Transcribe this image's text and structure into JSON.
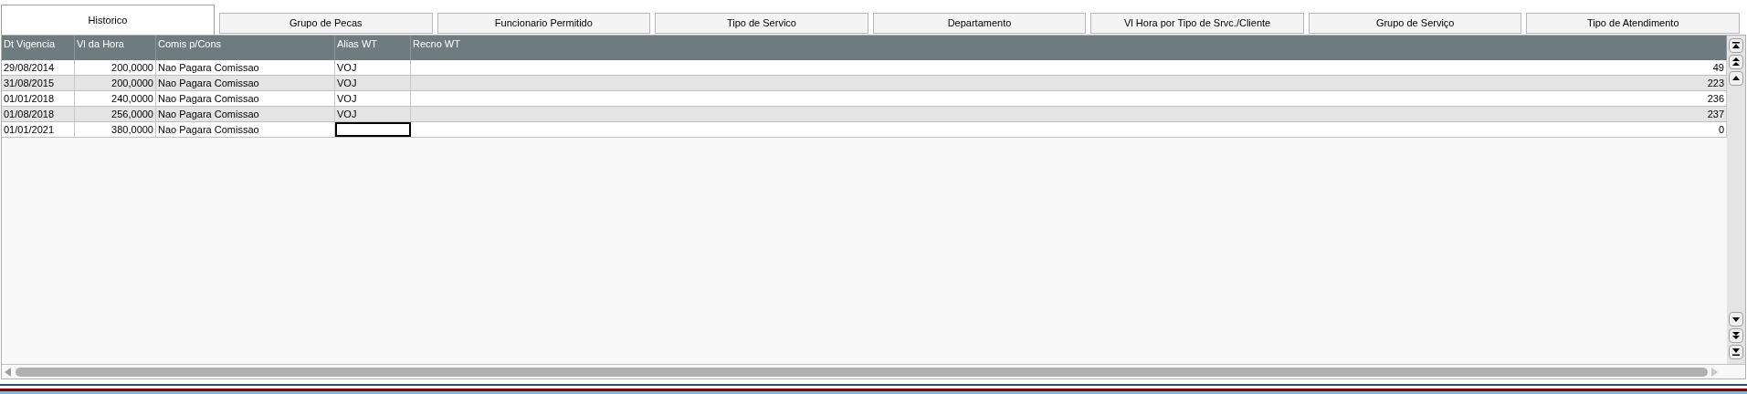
{
  "tabs": [
    {
      "label": "Historico",
      "selected": true
    },
    {
      "label": "Grupo de Pecas",
      "selected": false
    },
    {
      "label": "Funcionario Permitido",
      "selected": false
    },
    {
      "label": "Tipo de Servico",
      "selected": false
    },
    {
      "label": "Departamento",
      "selected": false
    },
    {
      "label": "Vl Hora por Tipo de Srvc./Cliente",
      "selected": false
    },
    {
      "label": "Grupo de Serviço",
      "selected": false
    },
    {
      "label": "Tipo de Atendimento",
      "selected": false
    }
  ],
  "table": {
    "columns": [
      "Dt Vigencia",
      "Vl da Hora",
      "Comis p/Cons",
      "Alias WT",
      "Recno WT"
    ],
    "rows": [
      {
        "cells": [
          "29/08/2014",
          "200,0000",
          "Nao Pagara Comissao",
          "VOJ",
          "49"
        ],
        "focused_cell": false
      },
      {
        "cells": [
          "31/08/2015",
          "200,0000",
          "Nao Pagara Comissao",
          "VOJ",
          "223"
        ],
        "focused_cell": false
      },
      {
        "cells": [
          "01/01/2018",
          "240,0000",
          "Nao Pagara Comissao",
          "VOJ",
          "236"
        ],
        "focused_cell": false
      },
      {
        "cells": [
          "01/08/2018",
          "256,0000",
          "Nao Pagara Comissao",
          "VOJ",
          "237"
        ],
        "focused_cell": false
      },
      {
        "cells": [
          "01/01/2021",
          "380,0000",
          "Nao Pagara Comissao",
          "",
          "0"
        ],
        "focused_cell": true
      }
    ]
  }
}
